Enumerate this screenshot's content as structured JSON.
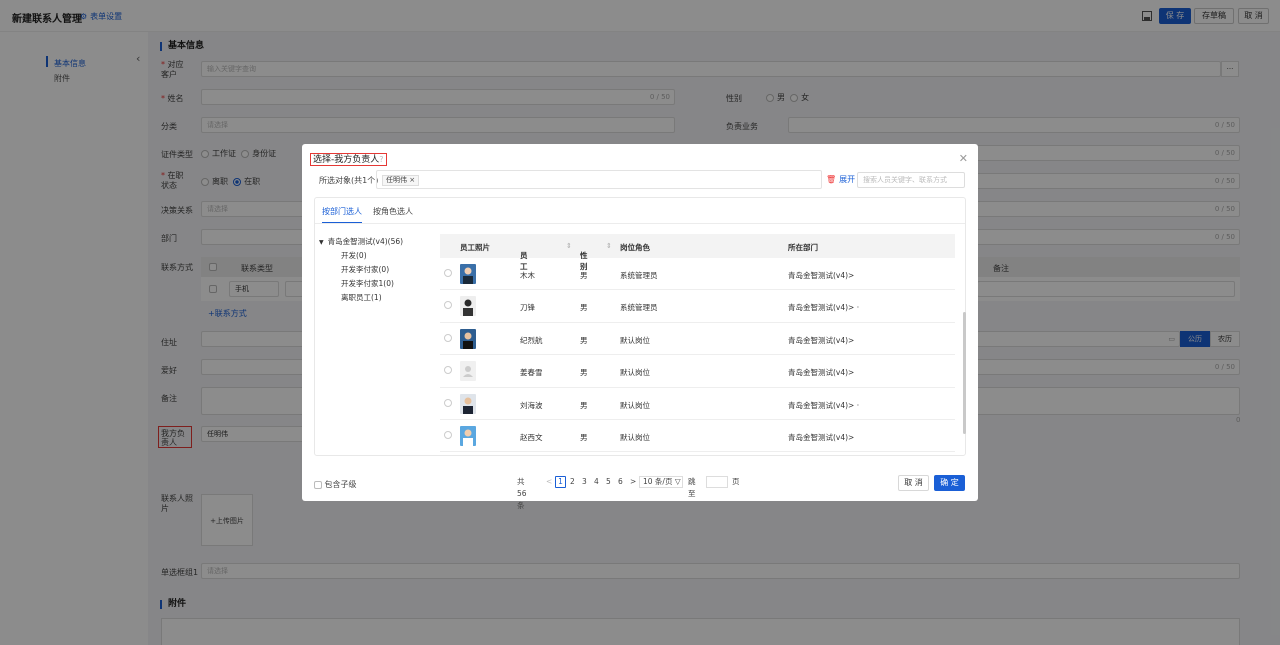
{
  "header": {
    "title": "新建联系人管理",
    "form_setting": "表单设置",
    "save": "保 存",
    "draft": "存草稿",
    "cancel": "取 消"
  },
  "leftnav": {
    "items": [
      "基本信息",
      "附件"
    ]
  },
  "form": {
    "section_basic": "基本信息",
    "section_attach": "附件",
    "labels": {
      "customer": "对应客户",
      "name": "姓名",
      "category": "分类",
      "cert_type": "证件类型",
      "job_status": "在职状态",
      "decision": "决策关系",
      "dept": "部门",
      "contact_method": "联系方式",
      "address": "住址",
      "hobby": "爱好",
      "remark": "备注",
      "owner": "我方负责人",
      "photo": "联系人照片",
      "single_group": "单选框组1",
      "gender": "性别",
      "business": "负责业务"
    },
    "placeholders": {
      "search_keyword": "输入关键字查询",
      "select": "请选择"
    },
    "counter_50": "0 / 50",
    "counter_0": "0",
    "gender_male": "男",
    "gender_female": "女",
    "cert_options": [
      "工作证",
      "身份证"
    ],
    "job_options": [
      "离职",
      "在职"
    ],
    "contact_col_type": "联系类型",
    "contact_col_remark": "备注",
    "contact_type_value": "手机",
    "add_contact": "+联系方式",
    "calendar_solar": "公历",
    "calendar_lunar": "农历",
    "owner_value": "任明伟",
    "upload": "+上传图片",
    "more": "···"
  },
  "modal": {
    "title": "选择-我方负责人",
    "help_icon": "?",
    "selected_label": "所选对象(共1个)",
    "selected_tag": "任明伟 ×",
    "expand": "展开",
    "search_placeholder": "搜索人员关键字、联系方式",
    "tabs": [
      "按部门选人",
      "按角色选人"
    ],
    "tree": {
      "root": "青岛金智测试(v4)(56)",
      "children": [
        "开发(0)",
        "开发李付家(0)",
        "开发李付家1(0)",
        "离职员工(1)"
      ]
    },
    "columns": {
      "photo": "员工照片",
      "name": "员工",
      "gender": "性别",
      "role": "岗位角色",
      "dept": "所在部门"
    },
    "rows": [
      {
        "name": "木木",
        "gender": "男",
        "role": "系统管理员",
        "dept": "青岛金智测试(v4)>"
      },
      {
        "name": "刀锋",
        "gender": "男",
        "role": "系统管理员",
        "dept": "青岛金智测试(v4)> ·"
      },
      {
        "name": "纪烈航",
        "gender": "男",
        "role": "默认岗位",
        "dept": "青岛金智测试(v4)>"
      },
      {
        "name": "姜春雪",
        "gender": "男",
        "role": "默认岗位",
        "dept": "青岛金智测试(v4)>"
      },
      {
        "name": "刘海波",
        "gender": "男",
        "role": "默认岗位",
        "dept": "青岛金智测试(v4)> ·"
      },
      {
        "name": "赵西文",
        "gender": "男",
        "role": "默认岗位",
        "dept": "青岛金智测试(v4)>"
      }
    ],
    "include_sub": "包含子级",
    "pager": {
      "total": "共56条",
      "prev": "<",
      "pages": [
        "1",
        "2",
        "3",
        "4",
        "5",
        "6"
      ],
      "next": ">",
      "size": "10 条/页 ▽",
      "jump": "跳至",
      "page_unit": "页"
    },
    "cancel": "取 消",
    "ok": "确 定"
  }
}
